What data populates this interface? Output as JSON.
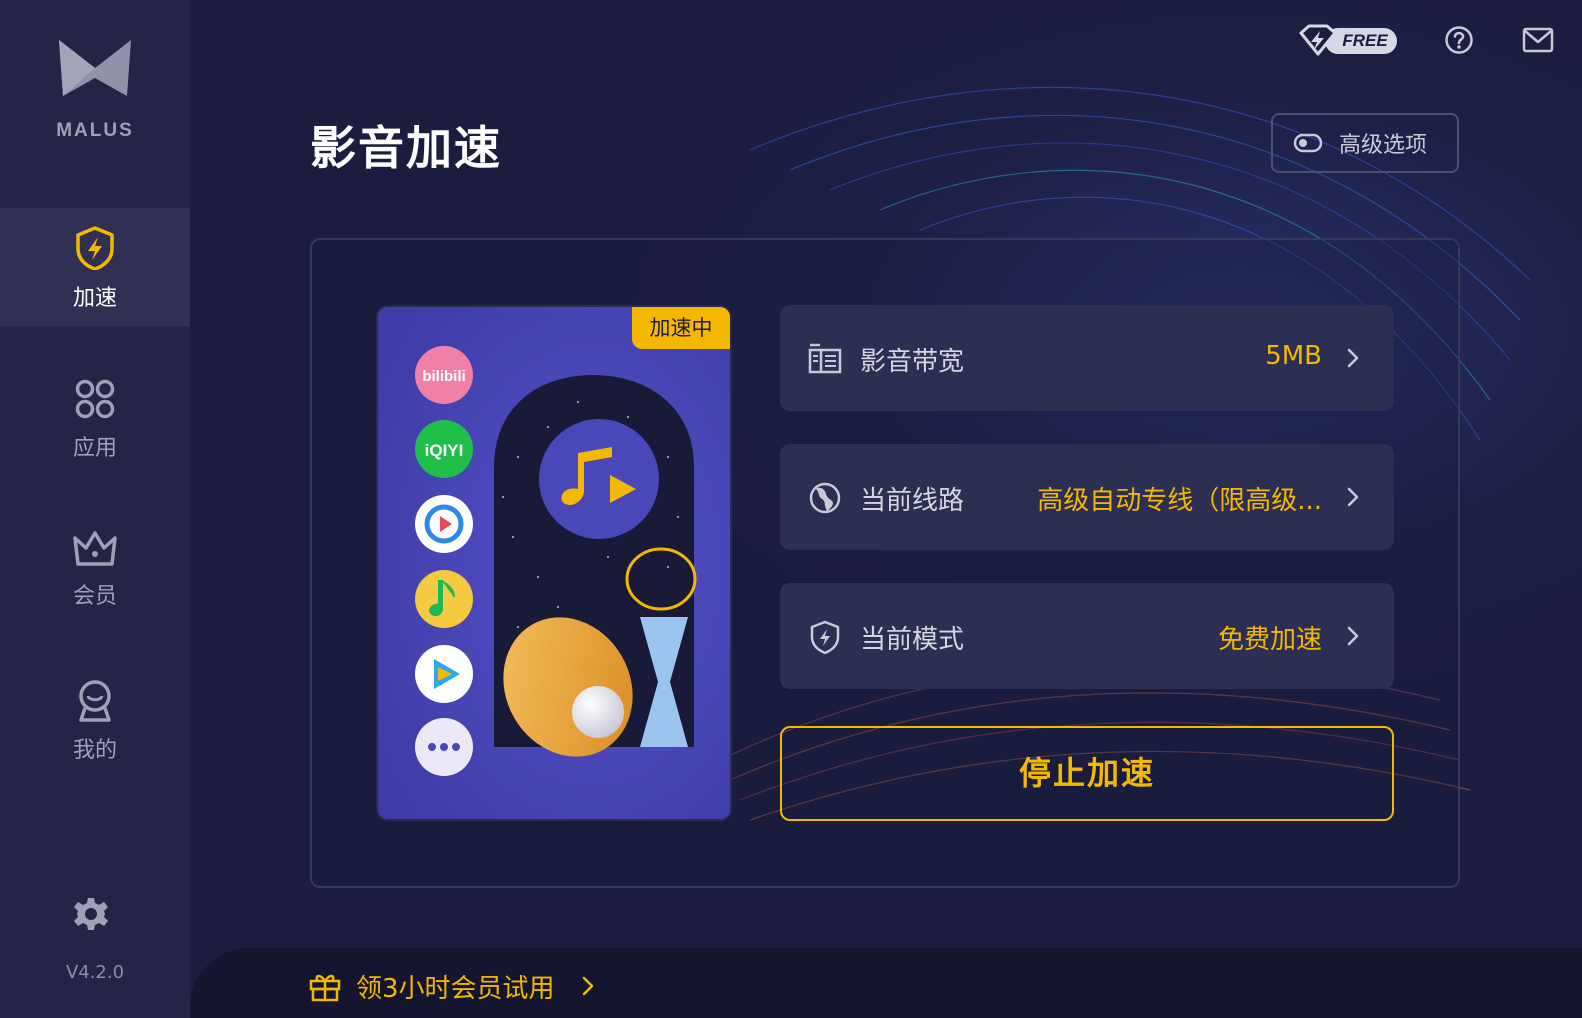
{
  "app": {
    "brand": "MALUS",
    "version": "V4.2.0"
  },
  "sidebar": {
    "items": [
      {
        "label": "加速",
        "icon": "shield-bolt-icon",
        "active": true
      },
      {
        "label": "应用",
        "icon": "apps-grid-icon",
        "active": false
      },
      {
        "label": "会员",
        "icon": "crown-icon",
        "active": false
      },
      {
        "label": "我的",
        "icon": "user-icon",
        "active": false
      }
    ],
    "settings_icon": "gear-icon"
  },
  "header": {
    "title": "影音加速",
    "free_badge": "FREE",
    "help_icon": "help-icon",
    "mail_icon": "mail-icon",
    "advanced_button": "高级选项"
  },
  "card": {
    "status_badge": "加速中",
    "apps": [
      "bilibili",
      "iQIYI",
      "Tencent Video",
      "QQ Music",
      "Tencent Video Play",
      "more"
    ]
  },
  "rows": [
    {
      "label": "影音带宽",
      "value": "5MB",
      "icon": "bandwidth-icon"
    },
    {
      "label": "当前线路",
      "value": "高级自动专线（限高级...",
      "icon": "globe-icon"
    },
    {
      "label": "当前模式",
      "value": "免费加速",
      "icon": "shield-bolt-icon"
    }
  ],
  "stop_button": "停止加速",
  "promo": {
    "text": "领3小时会员试用",
    "icon": "gift-icon"
  },
  "colors": {
    "accent": "#f5b800",
    "background": "#1b1c3e",
    "sidebar": "#232446",
    "row": "#2c2e52"
  }
}
